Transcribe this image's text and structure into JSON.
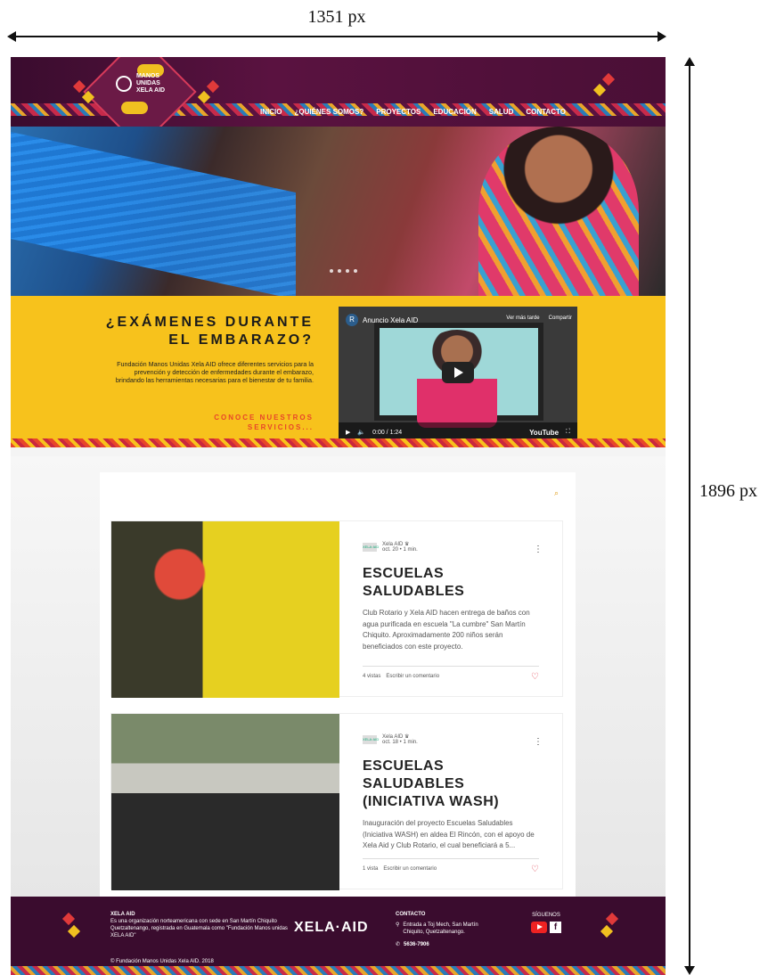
{
  "annotations": {
    "width_label": "1351 px",
    "height_label": "1896 px"
  },
  "header": {
    "logo_text": "MANOS UNIDAS XELA AID",
    "nav": [
      "INICIO",
      "¿QUIÉNES SOMOS?",
      "PROYECTOS",
      "EDUCACIÓN",
      "SALUD",
      "CONTACTO"
    ]
  },
  "promo": {
    "title": "¿EXÁMENES DURANTE EL EMBARAZO?",
    "text": "Fundación Manos Unidas Xela AID ofrece diferentes servicios para la prevención y detección de enfermedades durante el embarazo, brindando las herramientas necesarias para el bienestar de tu familia.",
    "link": "CONOCE NUESTROS SERVICIOS..."
  },
  "video": {
    "avatar_letter": "R",
    "title": "Anuncio Xela AID",
    "watch_later": "Ver más tarde",
    "share": "Compartir",
    "time": "0:00 / 1:24",
    "brand": "YouTube"
  },
  "posts": [
    {
      "author": "Xela AID",
      "logo": "XELA·AID",
      "meta": "oct. 20  •  1 min.",
      "title": "ESCUELAS SALUDABLES",
      "excerpt": "Club Rotario y Xela AID hacen entrega de baños con agua purificada en escuela \"La cumbre\" San Martín Chiquito. Aproximadamente 200 niños serán beneficiados con este proyecto.",
      "views": "4 vistas",
      "comment": "Escribir un comentario"
    },
    {
      "author": "Xela AID",
      "logo": "XELA·AID",
      "meta": "oct. 18  •  1 min.",
      "title": "ESCUELAS SALUDABLES (INICIATIVA WASH)",
      "excerpt": "Inauguración del proyecto Escuelas Saludables (Iniciativa WASH) en aldea El Rincón, con el apoyo de Xela Aid y Club Rotario, el cual beneficiará a 5...",
      "views": "1 vista",
      "comment": "Escribir un comentario"
    }
  ],
  "footer": {
    "org_name": "XELA AID",
    "org_desc": "Es una organización norteamericana con sede en San Martín Chiquito Quetzaltenango, registrada en Guatemala como \"Fundación Manos unidas XELA AID\"",
    "copyright": "© Fundación Manos Unidas Xela AID. 2018",
    "brand": "XELA·AID",
    "contact_title": "CONTACTO",
    "address": "Entrada a Toj Mech, San Martín Chiquito, Quetzaltenango.",
    "phone": "5636-7906",
    "social_title": "SÍGUENOS"
  },
  "colors": {
    "header_bg": "#3a0c2e",
    "promo_bg": "#f7c21c",
    "accent": "#e8462a",
    "heart": "#e04050"
  }
}
